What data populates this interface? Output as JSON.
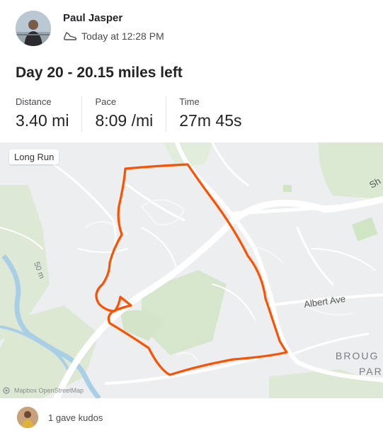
{
  "header": {
    "author_name": "Paul Jasper",
    "timestamp": "Today at 12:28 PM",
    "activity_icon": "running-shoe-icon"
  },
  "activity": {
    "title": "Day 20 - 20.15 miles left",
    "stats": [
      {
        "label": "Distance",
        "value": "3.40 mi"
      },
      {
        "label": "Pace",
        "value": "8:09 /mi"
      },
      {
        "label": "Time",
        "value": "27m 45s"
      }
    ]
  },
  "map": {
    "tag": "Long Run",
    "labels": {
      "street": "Albert Ave",
      "district_1": "BROUG",
      "district_2": "PAR",
      "contour": "50 m",
      "partial": "Sh"
    },
    "attribution": "Mapbox  OpenStreetMap",
    "route_color": "#fc5200"
  },
  "footer": {
    "kudos_text": "1 gave kudos"
  }
}
